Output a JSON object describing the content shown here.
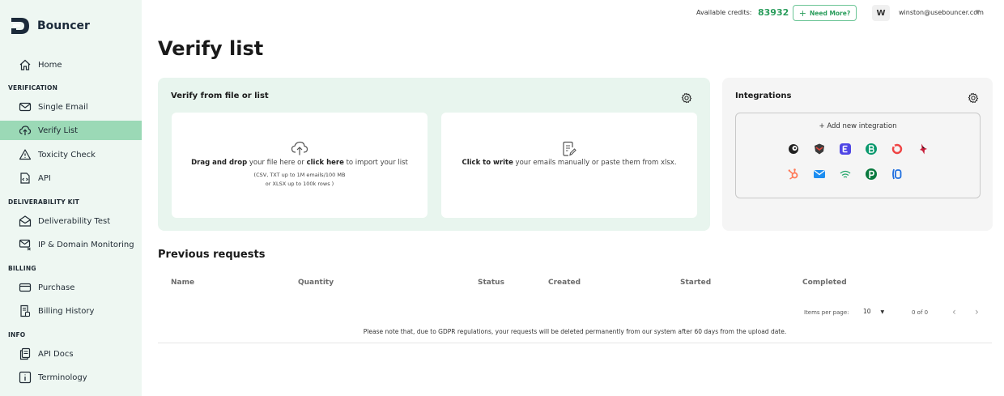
{
  "brand": {
    "name": "Bouncer"
  },
  "sidebar": {
    "home": "Home",
    "sections": {
      "verification": "VERIFICATION",
      "deliverability": "DELIVERABILITY KIT",
      "billing": "BILLING",
      "info": "INFO"
    },
    "items": {
      "single_email": "Single Email",
      "verify_list": "Verify List",
      "toxicity_check": "Toxicity Check",
      "api": "API",
      "deliverability_test": "Deliverability Test",
      "ip_domain_monitoring": "IP & Domain Monitoring",
      "purchase": "Purchase",
      "billing_history": "Billing History",
      "api_docs": "API Docs",
      "terminology": "Terminology"
    }
  },
  "header": {
    "credits_label": "Available credits:",
    "credits_value": "83932",
    "need_more": "Need More?",
    "avatar_initial": "W",
    "user_email": "winston@usebouncer.com"
  },
  "page": {
    "title": "Verify list"
  },
  "verify_card": {
    "title": "Verify from file or list",
    "upload": {
      "bold1": "Drag and drop",
      "text1": " your file here or ",
      "bold2": "click here",
      "text2": " to import your list",
      "sub1": "(CSV, TXT up to 1M emails/100 MB",
      "sub2": "or XLSX up to 100k rows )"
    },
    "write": {
      "bold": "Click to write",
      "text": " your emails manually or paste them from xlsx."
    }
  },
  "integrations": {
    "title": "Integrations",
    "add": "+ Add new integration"
  },
  "previous": {
    "title": "Previous requests",
    "columns": {
      "name": "Name",
      "quantity": "Quantity",
      "status": "Status",
      "created": "Created",
      "started": "Started",
      "completed": "Completed"
    },
    "pager": {
      "items_label": "Items per page:",
      "per_page": "10",
      "range": "0 of 0"
    },
    "gdpr_note": "Please note that, due to GDPR regulations, your requests will be deleted permanently from our system after 60 days from the upload date."
  },
  "colors": {
    "accent": "#2a9d5c",
    "active_bg": "#9bd9b6",
    "sidebar_bg": "#eef7f2",
    "card_bg": "#e8f5ee"
  }
}
